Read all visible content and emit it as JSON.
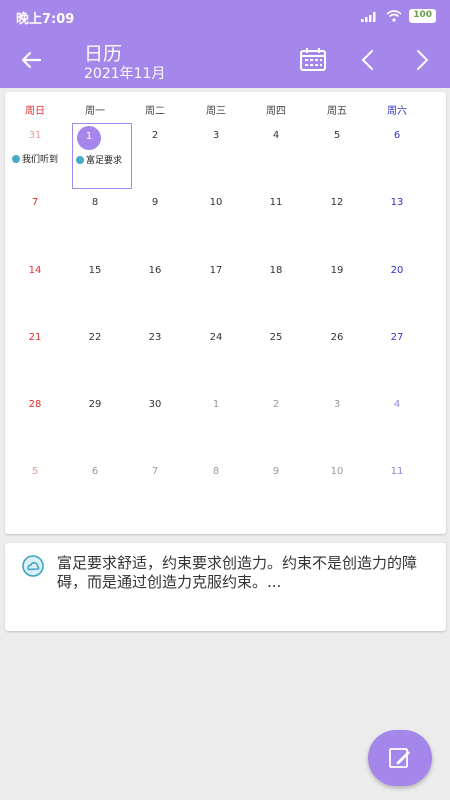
{
  "status_bar": {
    "time": "晚上7:09",
    "battery": "100"
  },
  "app_bar": {
    "title": "日历",
    "subtitle": "2021年11月"
  },
  "weekdays": [
    "周日",
    "周一",
    "周二",
    "周三",
    "周四",
    "周五",
    "周六"
  ],
  "weeks": [
    [
      "31",
      "1",
      "2",
      "3",
      "4",
      "5",
      "6"
    ],
    [
      "7",
      "8",
      "9",
      "10",
      "11",
      "12",
      "13"
    ],
    [
      "14",
      "15",
      "16",
      "17",
      "18",
      "19",
      "20"
    ],
    [
      "21",
      "22",
      "23",
      "24",
      "25",
      "26",
      "27"
    ],
    [
      "28",
      "29",
      "30",
      "1",
      "2",
      "3",
      "4"
    ],
    [
      "5",
      "6",
      "7",
      "8",
      "9",
      "10",
      "11"
    ]
  ],
  "selected_day": "1",
  "events": {
    "prev_31": "我们听到",
    "nov_1": "富足要求"
  },
  "note": "富足要求舒适，约束要求创造力。约束不是创造力的障碍，而是通过创造力克服约束。...",
  "colors": {
    "accent": "#a586ea",
    "sunday": "#e03030",
    "saturday": "#3030cc"
  },
  "icons": {
    "back": "arrow-left-icon",
    "calendar": "calendar-icon",
    "prev": "chevron-left-icon",
    "next": "chevron-right-icon",
    "note": "cloud-icon",
    "fab": "pencil-icon"
  }
}
